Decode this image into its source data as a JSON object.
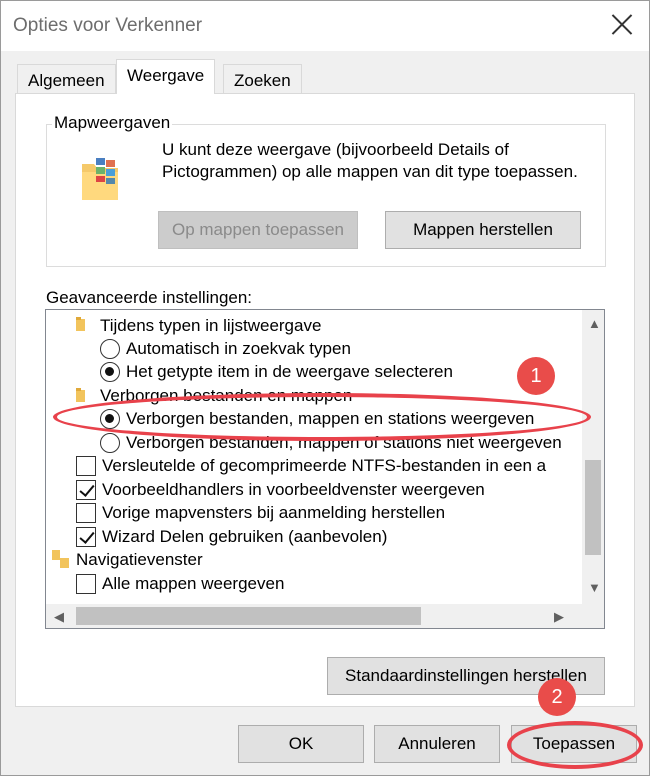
{
  "window": {
    "title": "Opties voor Verkenner"
  },
  "tabs": [
    {
      "label": "Algemeen"
    },
    {
      "label": "Weergave"
    },
    {
      "label": "Zoeken"
    }
  ],
  "folder_views": {
    "group_label": "Mapweergaven",
    "description": "U kunt deze weergave (bijvoorbeeld Details of Pictogrammen) op alle mappen van dit type toepassen.",
    "apply_button": "Op mappen toepassen",
    "reset_button": "Mappen herstellen"
  },
  "advanced": {
    "label": "Geavanceerde instellingen:",
    "items": [
      {
        "type": "folder",
        "label": "Tijdens typen in lijstweergave"
      },
      {
        "type": "radio",
        "label": "Automatisch in zoekvak typen",
        "checked": false
      },
      {
        "type": "radio",
        "label": "Het getypte item in de weergave selecteren",
        "checked": true
      },
      {
        "type": "folder",
        "label": "Verborgen bestanden en mappen"
      },
      {
        "type": "radio",
        "label": "Verborgen bestanden, mappen en stations weergeven",
        "checked": true
      },
      {
        "type": "radio",
        "label": "Verborgen bestanden, mappen of stations niet weergeven",
        "checked": false
      },
      {
        "type": "check",
        "label": "Versleutelde of gecomprimeerde NTFS-bestanden in een a",
        "checked": false
      },
      {
        "type": "check",
        "label": "Voorbeeldhandlers in voorbeeldvenster weergeven",
        "checked": true
      },
      {
        "type": "check",
        "label": "Vorige mapvensters bij aanmelding herstellen",
        "checked": false
      },
      {
        "type": "check",
        "label": "Wizard Delen gebruiken (aanbevolen)",
        "checked": true
      },
      {
        "type": "folder2",
        "label": "Navigatievenster"
      },
      {
        "type": "check",
        "label": "Alle mappen weergeven",
        "checked": false
      }
    ]
  },
  "restore_defaults_button": "Standaardinstellingen herstellen",
  "footer": {
    "ok": "OK",
    "cancel": "Annuleren",
    "apply": "Toepassen"
  },
  "annotations": {
    "badge1": "1",
    "badge2": "2",
    "color": "#e8424b"
  }
}
